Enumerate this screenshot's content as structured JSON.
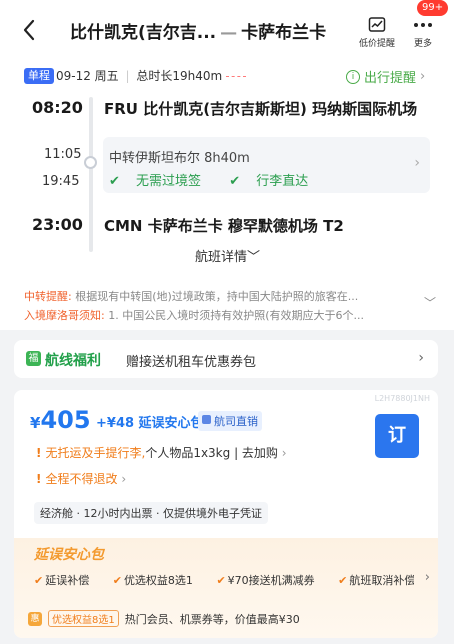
{
  "header": {
    "title_from": "比什凯克(吉尔吉...",
    "title_dash": "—",
    "title_to": "卡萨布兰卡",
    "price_alert_label": "低价提醒",
    "more_label": "更多",
    "badge": "99+"
  },
  "flight": {
    "tag": "单程",
    "date": "09-12 周五",
    "duration_sep": "|",
    "duration": "总时长19h40m",
    "reminder_icon": "i",
    "reminder": "出行提醒",
    "dep_time": "08:20",
    "dep_airport": "FRU 比什凯克(吉尔吉斯斯坦) 玛纳斯国际机场",
    "seg_arr_time": "11:05",
    "seg_dep_time": "19:45",
    "transfer": "中转伊斯坦布尔 8h40m",
    "no_visa": "无需过境签",
    "baggage_through": "行李直达",
    "arr_time": "23:00",
    "arr_airport": "CMN 卡萨布兰卡 穆罕默德机场 T2",
    "details_link": "航班详情"
  },
  "notices": {
    "transfer_label": "中转提醒:",
    "transfer_text": "根据现有中转国(地)过境政策，持中国大陆护照的旅客在...",
    "entry_label": "入境摩洛哥须知:",
    "entry_text": "1. 中国公民入境时须持有效护照(有效期应大于6个..."
  },
  "promo": {
    "icon_text": "福",
    "title": "航线福利",
    "desc": "赠接送机租车优惠券包"
  },
  "offer": {
    "code": "L2H7880J1NH",
    "currency": "¥",
    "price": "405",
    "addon": "+¥48 延误安心包",
    "direct": "航司直销",
    "book": "订",
    "warn1_a": "无托运及手提行李,",
    "warn1_b": "个人物品1x3kg | 去加购",
    "warn2": "全程不得退改",
    "cabin": "经济舱 · 12小时内出票 · 仅提供境外电子凭证",
    "delay_title": "延误安心包",
    "delay_items": [
      "延误补偿",
      "优选权益8选1",
      "¥70接送机满减券",
      "航班取消补偿"
    ],
    "bottom_icon": "惠",
    "bottom_chip": "优选权益8选1",
    "bottom_text": "热门会员、机票券等，价值最高¥30"
  }
}
